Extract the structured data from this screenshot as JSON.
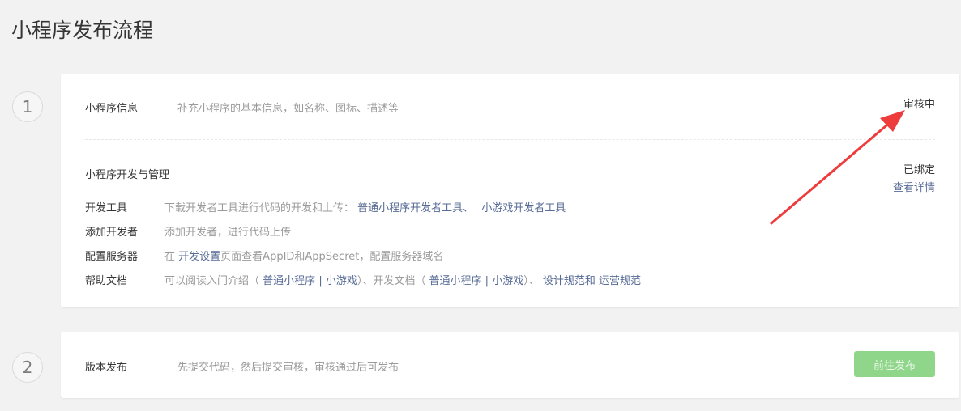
{
  "page": {
    "title": "小程序发布流程"
  },
  "steps": [
    {
      "number": "1"
    },
    {
      "number": "2"
    }
  ],
  "info": {
    "label": "小程序信息",
    "desc": "补充小程序的基本信息，如名称、图标、描述等",
    "status": "审核中"
  },
  "dev": {
    "label": "小程序开发与管理",
    "status": "已绑定",
    "detail_link": "查看详情",
    "rows": {
      "tools": {
        "label": "开发工具",
        "desc": "下载开发者工具进行代码的开发和上传：",
        "link1": "普通小程序开发者工具、",
        "link2": "小游戏开发者工具"
      },
      "add_dev": {
        "label": "添加开发者",
        "desc": "添加开发者，进行代码上传"
      },
      "server": {
        "label": "配置服务器",
        "prefix": "在",
        "link": "开发设置",
        "suffix": "页面查看AppID和AppSecret，配置服务器域名"
      },
      "docs": {
        "label": "帮助文档",
        "t1": "可以阅读入门介绍（",
        "l1": "普通小程序",
        "sep1": "|",
        "l2": "小游戏",
        "t2": "）、开发文档（",
        "l3": "普通小程序",
        "sep2": "|",
        "l4": "小游戏",
        "t3": "）、",
        "l5": "设计规范和",
        "l6": "运营规范"
      }
    }
  },
  "release": {
    "label": "版本发布",
    "desc": "先提交代码，然后提交审核，审核通过后可发布",
    "button": "前往发布"
  },
  "colors": {
    "link": "#576b95",
    "button": "#8fd68a",
    "arrow": "#ee3b3b"
  }
}
